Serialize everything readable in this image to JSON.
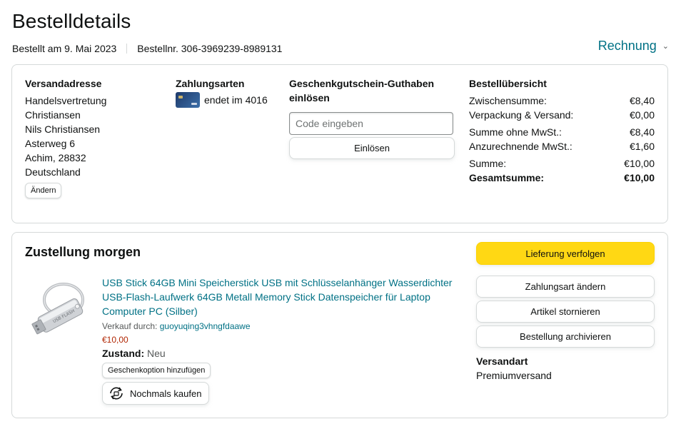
{
  "header": {
    "title": "Bestelldetails",
    "ordered_on": "Bestellt am 9. Mai 2023",
    "order_number": "Bestellnr. 306-3969239-8989131",
    "invoice_label": "Rechnung"
  },
  "address": {
    "heading": "Versandadresse",
    "lines": [
      "Handelsvertretung",
      "Christiansen",
      "Nils Christiansen",
      "Asterweg 6",
      "Achim, 28832",
      "Deutschland"
    ],
    "change_label": "Ändern"
  },
  "payment": {
    "heading": "Zahlungsarten",
    "card_text": "endet im 4016"
  },
  "gift_card": {
    "heading": "Geschenkgutschein-Guthaben einlösen",
    "placeholder": "Code eingeben",
    "redeem_label": "Einlösen"
  },
  "summary": {
    "heading": "Bestellübersicht",
    "subtotal_label": "Zwischensumme:",
    "subtotal_value": "€8,40",
    "shipping_label": "Verpackung & Versand:",
    "shipping_value": "€0,00",
    "net_label": "Summe ohne MwSt.:",
    "net_value": "€8,40",
    "vat_label": "Anzurechnende MwSt.:",
    "vat_value": "€1,60",
    "sum_label": "Summe:",
    "sum_value": "€10,00",
    "total_label": "Gesamtsumme:",
    "total_value": "€10,00"
  },
  "delivery": {
    "title": "Zustellung morgen",
    "product_title": "USB Stick 64GB Mini Speicherstick USB mit Schlüsselanhänger Wasserdichter USB-Flash-Laufwerk 64GB Metall Memory Stick Datenspeicher für Laptop Computer PC (Silber)",
    "sold_by_label": "Verkauf durch:",
    "seller": "guoyuqing3vhngfdaawe",
    "price": "€10,00",
    "condition_label": "Zustand:",
    "condition_value": "Neu",
    "gift_option_label": "Geschenkoption hinzufügen",
    "buy_again_label": "Nochmals kaufen",
    "image_engraving": "USB FLASH"
  },
  "actions": {
    "track": "Lieferung verfolgen",
    "change_payment": "Zahlungsart ändern",
    "cancel": "Artikel stornieren",
    "archive": "Bestellung archivieren",
    "shipping_method_heading": "Versandart",
    "shipping_method_value": "Premiumversand"
  },
  "colors": {
    "link": "#007185",
    "price": "#b12704",
    "primary_button": "#ffd814",
    "border": "#d5d9d9"
  }
}
